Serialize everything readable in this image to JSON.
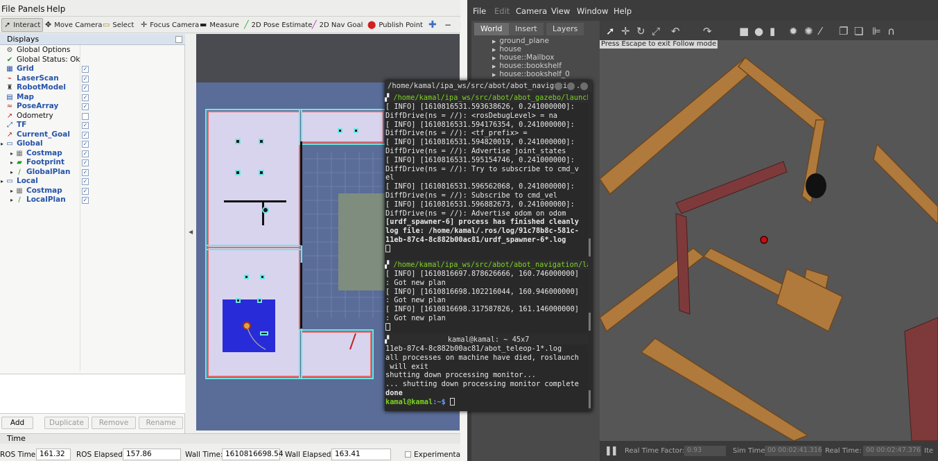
{
  "rviz": {
    "menu": [
      "File",
      "Panels",
      "Help"
    ],
    "tools": [
      "Interact",
      "Move Camera",
      "Select",
      "Focus Camera",
      "Measure",
      "2D Pose Estimate",
      "2D Nav Goal",
      "Publish Point"
    ],
    "displays_title": "Displays",
    "displays": [
      {
        "label": "Global Options",
        "icon": "gear-icon",
        "style": "plain",
        "checked": null,
        "indent": 1,
        "arrow": false
      },
      {
        "label": "Global Status: Ok",
        "icon": "check-icon",
        "style": "plain",
        "checked": null,
        "indent": 1,
        "arrow": false
      },
      {
        "label": "Grid",
        "icon": "grid-icon",
        "style": "blue",
        "checked": true,
        "indent": 1,
        "arrow": false
      },
      {
        "label": "LaserScan",
        "icon": "laser-icon",
        "style": "blue",
        "checked": true,
        "indent": 1,
        "arrow": false
      },
      {
        "label": "RobotModel",
        "icon": "robot-icon",
        "style": "blue",
        "checked": true,
        "indent": 1,
        "arrow": false
      },
      {
        "label": "Map",
        "icon": "map-icon",
        "style": "blue",
        "checked": true,
        "indent": 1,
        "arrow": false
      },
      {
        "label": "PoseArray",
        "icon": "posearray-icon",
        "style": "blue",
        "checked": true,
        "indent": 1,
        "arrow": false
      },
      {
        "label": "Odometry",
        "icon": "odometry-icon",
        "style": "plain",
        "checked": false,
        "indent": 1,
        "arrow": false
      },
      {
        "label": "TF",
        "icon": "tf-icon",
        "style": "blue",
        "checked": true,
        "indent": 1,
        "arrow": false
      },
      {
        "label": "Current_Goal",
        "icon": "pose-icon",
        "style": "blue",
        "checked": true,
        "indent": 1,
        "arrow": false
      },
      {
        "label": "Global",
        "icon": "folder-icon",
        "style": "blue",
        "checked": true,
        "indent": 0,
        "arrow": true
      },
      {
        "label": "Costmap",
        "icon": "costmap-icon",
        "style": "blue",
        "checked": true,
        "indent": 2,
        "arrow": true
      },
      {
        "label": "Footprint",
        "icon": "footprint-icon",
        "style": "blue",
        "checked": true,
        "indent": 2,
        "arrow": true
      },
      {
        "label": "GlobalPlan",
        "icon": "path-icon",
        "style": "blue",
        "checked": true,
        "indent": 2,
        "arrow": true
      },
      {
        "label": "Local",
        "icon": "folder-icon",
        "style": "blue",
        "checked": true,
        "indent": 0,
        "arrow": true
      },
      {
        "label": "Costmap",
        "icon": "costmap-icon",
        "style": "blue",
        "checked": true,
        "indent": 2,
        "arrow": true
      },
      {
        "label": "LocalPlan",
        "icon": "path-icon",
        "style": "blue",
        "checked": true,
        "indent": 2,
        "arrow": true
      }
    ],
    "buttons": {
      "add": "Add",
      "duplicate": "Duplicate",
      "remove": "Remove",
      "rename": "Rename"
    },
    "time": {
      "title": "Time",
      "ros_time_label": "ROS Time:",
      "ros_time": "161.32",
      "ros_elapsed_label": "ROS Elapsed:",
      "ros_elapsed": "157.86",
      "wall_time_label": "Wall Time:",
      "wall_time": "1610816698.54",
      "wall_elapsed_label": "Wall Elapsed:",
      "wall_elapsed": "163.41",
      "experimental_label": "Experimental"
    }
  },
  "terminal": {
    "title": "/home/kamal/ipa_ws/src/abot/abot_navigati...",
    "pane1_header": "/home/kamal/ipa_ws/src/abot/abot_gazebo/launch/robot",
    "pane1_lines": [
      "[ INFO] [1610816531.593638626, 0.241000000]:",
      "DiffDrive(ns = //): <rosDebugLevel> = na",
      "[ INFO] [1610816531.594176354, 0.241000000]:",
      "DiffDrive(ns = //): <tf_prefix> =",
      "[ INFO] [1610816531.594820019, 0.241000000]:",
      "DiffDrive(ns = //): Advertise joint_states",
      "[ INFO] [1610816531.595154746, 0.241000000]:",
      "DiffDrive(ns = //): Try to subscribe to cmd_v",
      "el",
      "[ INFO] [1610816531.596562068, 0.241000000]:",
      "DiffDrive(ns = //): Subscribe to cmd_vel",
      "[ INFO] [1610816531.596882673, 0.241000000]:",
      "DiffDrive(ns = //): Advertise odom on odom"
    ],
    "pane1_bold": [
      "[urdf_spawner-6] process has finished cleanly",
      "log file: /home/kamal/.ros/log/91c78b8c-581c-",
      "11eb-87c4-8c882b00ac81/urdf_spawner-6*.log"
    ],
    "pane2_header": "/home/kamal/ipa_ws/src/abot/abot_navigation/launch/abo",
    "pane2_lines": [
      "[ INFO] [1610816697.878626666, 160.746000000]",
      ": Got new plan",
      "[ INFO] [1610816698.102216044, 160.946000000]",
      ": Got new plan",
      "[ INFO] [1610816698.317587826, 161.146000000]",
      ": Got new plan"
    ],
    "pane3_header": "kamal@kamal: ~ 45x7",
    "pane3_lines": [
      "11eb-87c4-8c882b00ac81/abot_teleop-1*.log",
      "all processes on machine have died, roslaunch",
      " will exit",
      "shutting down processing monitor...",
      "... shutting down processing monitor complete"
    ],
    "pane3_done": "done",
    "prompt_user": "kamal@kamal",
    "prompt_path": ":~$"
  },
  "gazebo": {
    "menu": [
      "File",
      "Edit",
      "Camera",
      "View",
      "Window",
      "Help"
    ],
    "tabs": [
      "World",
      "Insert",
      "Layers"
    ],
    "models": [
      "ground_plane",
      "house",
      "house::Mailbox",
      "house::bookshelf",
      "house::bookshelf_0"
    ],
    "esc_hint": "Press Escape to exit Follow mode",
    "status": {
      "rtf_label": "Real Time Factor:",
      "rtf": "0.93",
      "sim_time_label": "Sim Time:",
      "sim_time": "00 00:02:41.316",
      "real_time_label": "Real Time:",
      "real_time": "00 00:02:47.376",
      "iterations_label": "Ite"
    }
  },
  "colors": {
    "rviz_bg": "#efefed",
    "map_free": "#d9d4ee",
    "costmap_local": "#1f23d6",
    "terminal_bg": "#2b2b2b",
    "terminal_green": "#7ed321",
    "gazebo_bg": "#3b3b3b",
    "wall_wood": "#b07a3c"
  }
}
